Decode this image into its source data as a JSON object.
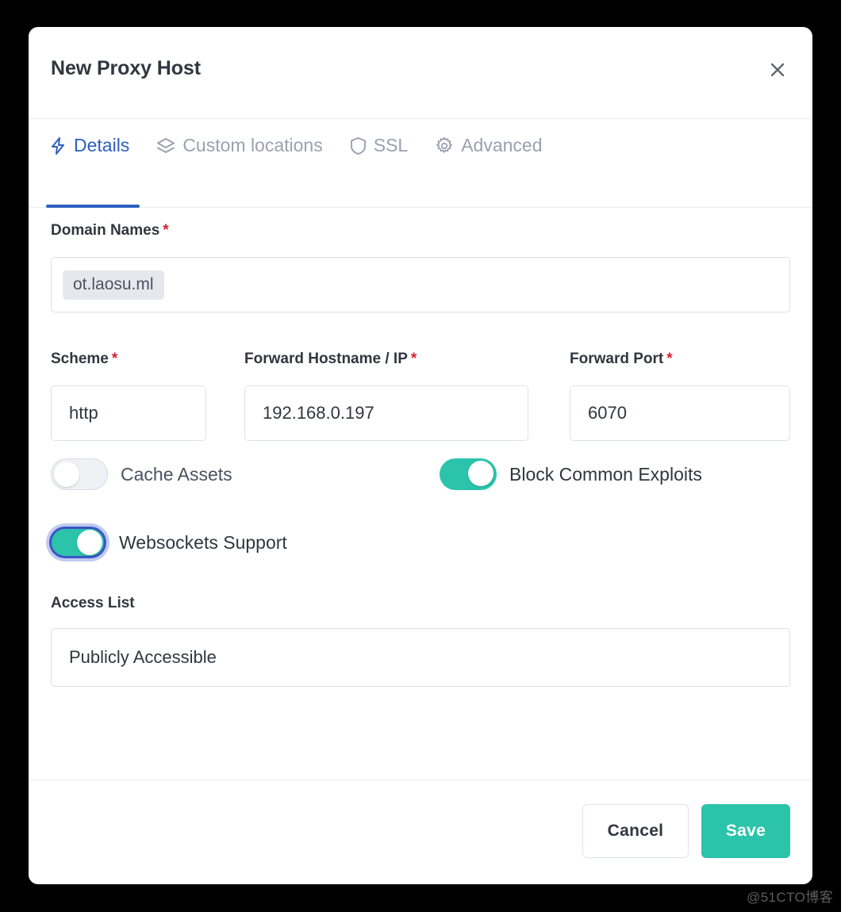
{
  "window": {
    "title": "New Proxy Host",
    "close_icon": "close-icon"
  },
  "tabs": [
    {
      "label": "Details",
      "icon": "lightning-bolt-icon",
      "active": true
    },
    {
      "label": "Custom locations",
      "icon": "layers-icon",
      "active": false
    },
    {
      "label": "SSL",
      "icon": "shield-icon",
      "active": false
    },
    {
      "label": "Advanced",
      "icon": "gear-icon",
      "active": false
    }
  ],
  "form": {
    "domain_names": {
      "label": "Domain Names",
      "required_marker": "*",
      "chips": [
        "ot.laosu.ml"
      ]
    },
    "scheme": {
      "label": "Scheme",
      "required_marker": "*",
      "value": "http"
    },
    "forward_hostname": {
      "label": "Forward Hostname / IP",
      "required_marker": "*",
      "value": "192.168.0.197"
    },
    "forward_port": {
      "label": "Forward Port",
      "required_marker": "*",
      "value": "6070"
    },
    "cache_assets": {
      "label": "Cache Assets",
      "state": "off"
    },
    "block_common_exploits": {
      "label": "Block Common Exploits",
      "state": "on"
    },
    "websockets_support": {
      "label": "Websockets Support",
      "state": "on",
      "focused": true
    },
    "access_list": {
      "label": "Access List",
      "value": "Publicly Accessible"
    }
  },
  "footer": {
    "cancel_label": "Cancel",
    "save_label": "Save"
  },
  "watermark": {
    "text": "@51CTO博客"
  },
  "colors": {
    "accent_blue": "#2c5fc0",
    "accent_teal": "#2bc4ab",
    "required_red": "#d32030",
    "text_dark": "#31363f",
    "text_muted": "#9aa0ae",
    "border": "#dde1e7",
    "chip_bg": "#e6e8ed",
    "page_bg": "#000000"
  }
}
